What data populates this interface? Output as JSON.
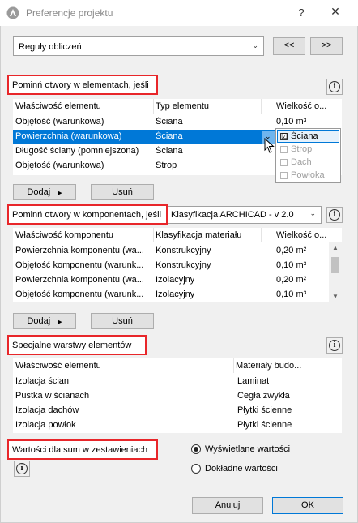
{
  "window": {
    "title": "Preferencje projektu",
    "help": "?",
    "close": "✕"
  },
  "top": {
    "dropdown_value": "Reguły obliczeń",
    "prev_label": "<<",
    "next_label": ">>"
  },
  "section1": {
    "title": "Pominń otwory w elementach, jeśli",
    "columns": [
      "Właściwość elementu",
      "Typ elementu",
      "Wielkość o..."
    ],
    "rows": [
      [
        "Objętość (warunkowa)",
        "Ściana",
        "0,10 m³"
      ],
      [
        "Powierzchnia (warunkowa)",
        "Ściana",
        ""
      ],
      [
        "Długość ściany (pomniejszona)",
        "Ściana",
        ""
      ],
      [
        "Objętość (warunkowa)",
        "Strop",
        ""
      ]
    ],
    "popup_items": [
      {
        "label": "Ściana",
        "checked": "☑"
      },
      {
        "label": "Strop",
        "checked": ""
      },
      {
        "label": "Dach",
        "checked": ""
      },
      {
        "label": "Powłoka",
        "checked": ""
      }
    ],
    "add_label": "Dodaj",
    "remove_label": "Usuń"
  },
  "section2": {
    "title": "Pominń otwory w komponentach, jeśli",
    "classification": "Klasyfikacja ARCHICAD - v 2.0",
    "columns": [
      "Właściwość komponentu",
      "Klasyfikacja materiału",
      "Wielkość o..."
    ],
    "rows": [
      [
        "Powierzchnia komponentu (wa...",
        "Konstrukcyjny",
        "0,20 m²"
      ],
      [
        "Objętość komponentu (warunk...",
        "Konstrukcyjny",
        "0,10 m³"
      ],
      [
        "Powierzchnia komponentu (wa...",
        "Izolacyjny",
        "0,20 m²"
      ],
      [
        "Objętość komponentu (warunk...",
        "Izolacyjny",
        "0,10 m³"
      ]
    ],
    "add_label": "Dodaj",
    "remove_label": "Usuń"
  },
  "section3": {
    "title": "Specjalne warstwy elementów",
    "columns": [
      "Właściwość elementu",
      "Materiały budo..."
    ],
    "rows": [
      [
        "Izolacja ścian",
        "Laminat"
      ],
      [
        "Pustka w ścianach",
        "Cegła zwykła"
      ],
      [
        "Izolacja dachów",
        "Płytki ścienne"
      ],
      [
        "Izolacja powłok",
        "Płytki ścienne"
      ]
    ]
  },
  "section4": {
    "title": "Wartości dla sum w zestawieniach",
    "radio_displayed": "Wyświetlane wartości",
    "radio_exact": "Dokładne wartości",
    "selected": "displayed"
  },
  "footer": {
    "cancel_label": "Anuluj",
    "ok_label": "OK"
  }
}
